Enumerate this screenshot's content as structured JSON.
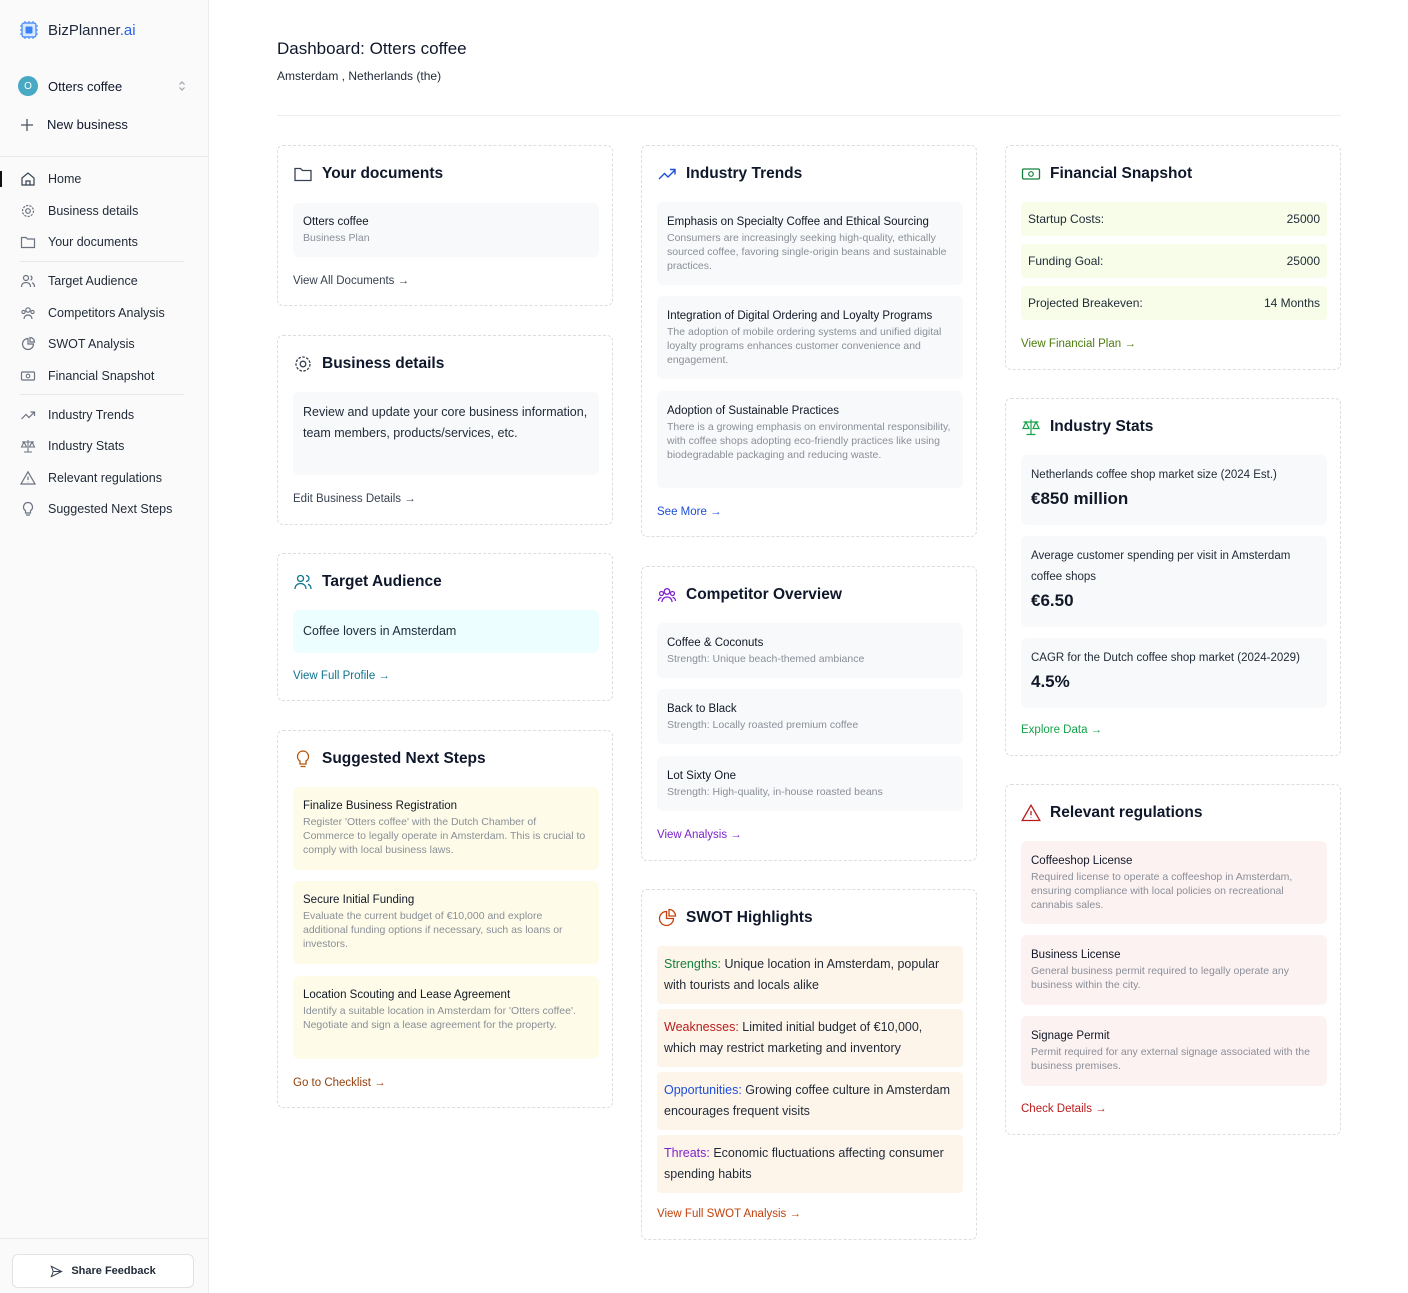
{
  "brand": {
    "name": "BizPlanner",
    "suffix": ".ai"
  },
  "business_switcher": {
    "initial": "O",
    "name": "Otters coffee"
  },
  "new_business": "New business",
  "nav": {
    "home": "Home",
    "business_details": "Business details",
    "your_documents": "Your documents",
    "target_audience": "Target Audience",
    "competitors": "Competitors Analysis",
    "swot": "SWOT Analysis",
    "financial": "Financial Snapshot",
    "industry_trends": "Industry Trends",
    "industry_stats": "Industry Stats",
    "regulations": "Relevant regulations",
    "next_steps": "Suggested Next Steps"
  },
  "feedback": "Share Feedback",
  "header": {
    "title": "Dashboard: Otters coffee",
    "location": "Amsterdam , Netherlands (the)"
  },
  "documents": {
    "title": "Your documents",
    "item_title": "Otters coffee",
    "item_sub": "Business Plan",
    "link": "View All Documents →"
  },
  "business_details": {
    "title": "Business details",
    "text": "Review and update your core business information, team members, products/services, etc.",
    "link": "Edit Business Details →"
  },
  "target_audience": {
    "title": "Target Audience",
    "text": "Coffee lovers in Amsterdam",
    "link": "View Full Profile →"
  },
  "next_steps": {
    "title": "Suggested Next Steps",
    "items": [
      {
        "title": "Finalize Business Registration",
        "desc": "Register 'Otters coffee' with the Dutch Chamber of Commerce to legally operate in Amsterdam. This is crucial to comply with local business laws."
      },
      {
        "title": "Secure Initial Funding",
        "desc": "Evaluate the current budget of €10,000 and explore additional funding options if necessary, such as loans or investors."
      },
      {
        "title": "Location Scouting and Lease Agreement",
        "desc": "Identify a suitable location in Amsterdam for 'Otters coffee'. Negotiate and sign a lease agreement for the property."
      }
    ],
    "link": "Go to Checklist →"
  },
  "industry_trends": {
    "title": "Industry Trends",
    "items": [
      {
        "title": "Emphasis on Specialty Coffee and Ethical Sourcing",
        "desc": "Consumers are increasingly seeking high-quality, ethically sourced coffee, favoring single-origin beans and sustainable practices."
      },
      {
        "title": "Integration of Digital Ordering and Loyalty Programs",
        "desc": "The adoption of mobile ordering systems and unified digital loyalty programs enhances customer convenience and engagement."
      },
      {
        "title": "Adoption of Sustainable Practices",
        "desc": "There is a growing emphasis on environmental responsibility, with coffee shops adopting eco-friendly practices like using biodegradable packaging and reducing waste."
      }
    ],
    "link": "See More →"
  },
  "competitors": {
    "title": "Competitor Overview",
    "items": [
      {
        "title": "Coffee & Coconuts",
        "desc": "Strength: Unique beach-themed ambiance"
      },
      {
        "title": "Back to Black",
        "desc": "Strength: Locally roasted premium coffee"
      },
      {
        "title": "Lot Sixty One",
        "desc": "Strength: High-quality, in-house roasted beans"
      }
    ],
    "link": "View Analysis →"
  },
  "swot": {
    "title": "SWOT Highlights",
    "items": [
      {
        "label": "Strengths:",
        "text": " Unique location in Amsterdam, popular with tourists and locals alike",
        "color": "#15803d"
      },
      {
        "label": "Weaknesses:",
        "text": " Limited initial budget of €10,000, which may restrict marketing and inventory",
        "color": "#b91c1c"
      },
      {
        "label": "Opportunities:",
        "text": " Growing coffee culture in Amsterdam encourages frequent visits",
        "color": "#1d4ed8"
      },
      {
        "label": "Threats:",
        "text": " Economic fluctuations affecting consumer spending habits",
        "color": "#7e22ce"
      }
    ],
    "link": "View Full SWOT Analysis →"
  },
  "financial": {
    "title": "Financial Snapshot",
    "rows": [
      {
        "label": "Startup Costs:",
        "value": "25000"
      },
      {
        "label": "Funding Goal:",
        "value": "25000"
      },
      {
        "label": "Projected Breakeven:",
        "value": "14 Months"
      }
    ],
    "link": "View Financial Plan →"
  },
  "industry_stats": {
    "title": "Industry Stats",
    "items": [
      {
        "title": "Netherlands coffee shop market size (2024 Est.)",
        "value": "€850 million"
      },
      {
        "title": "Average customer spending per visit in Amsterdam coffee shops",
        "value": "€6.50"
      },
      {
        "title": "CAGR for the Dutch coffee shop market (2024-2029)",
        "value": "4.5%"
      }
    ],
    "link": "Explore Data →"
  },
  "regulations": {
    "title": "Relevant regulations",
    "items": [
      {
        "title": "Coffeeshop License",
        "desc": "Required license to operate a coffeeshop in Amsterdam, ensuring compliance with local policies on recreational cannabis sales."
      },
      {
        "title": "Business License",
        "desc": "General business permit required to legally operate any business within the city."
      },
      {
        "title": "Signage Permit",
        "desc": "Permit required for any external signage associated with the business premises."
      }
    ],
    "link": "Check Details →"
  },
  "colors": {
    "blue_link": "#1d4ed8",
    "teal_link": "#0e7490",
    "green_link": "#4d7c0f",
    "stats_green": "#16a34a",
    "purple": "#7e22ce",
    "orange": "#c2410c",
    "red": "#b91c1c",
    "brown": "#92400e"
  }
}
